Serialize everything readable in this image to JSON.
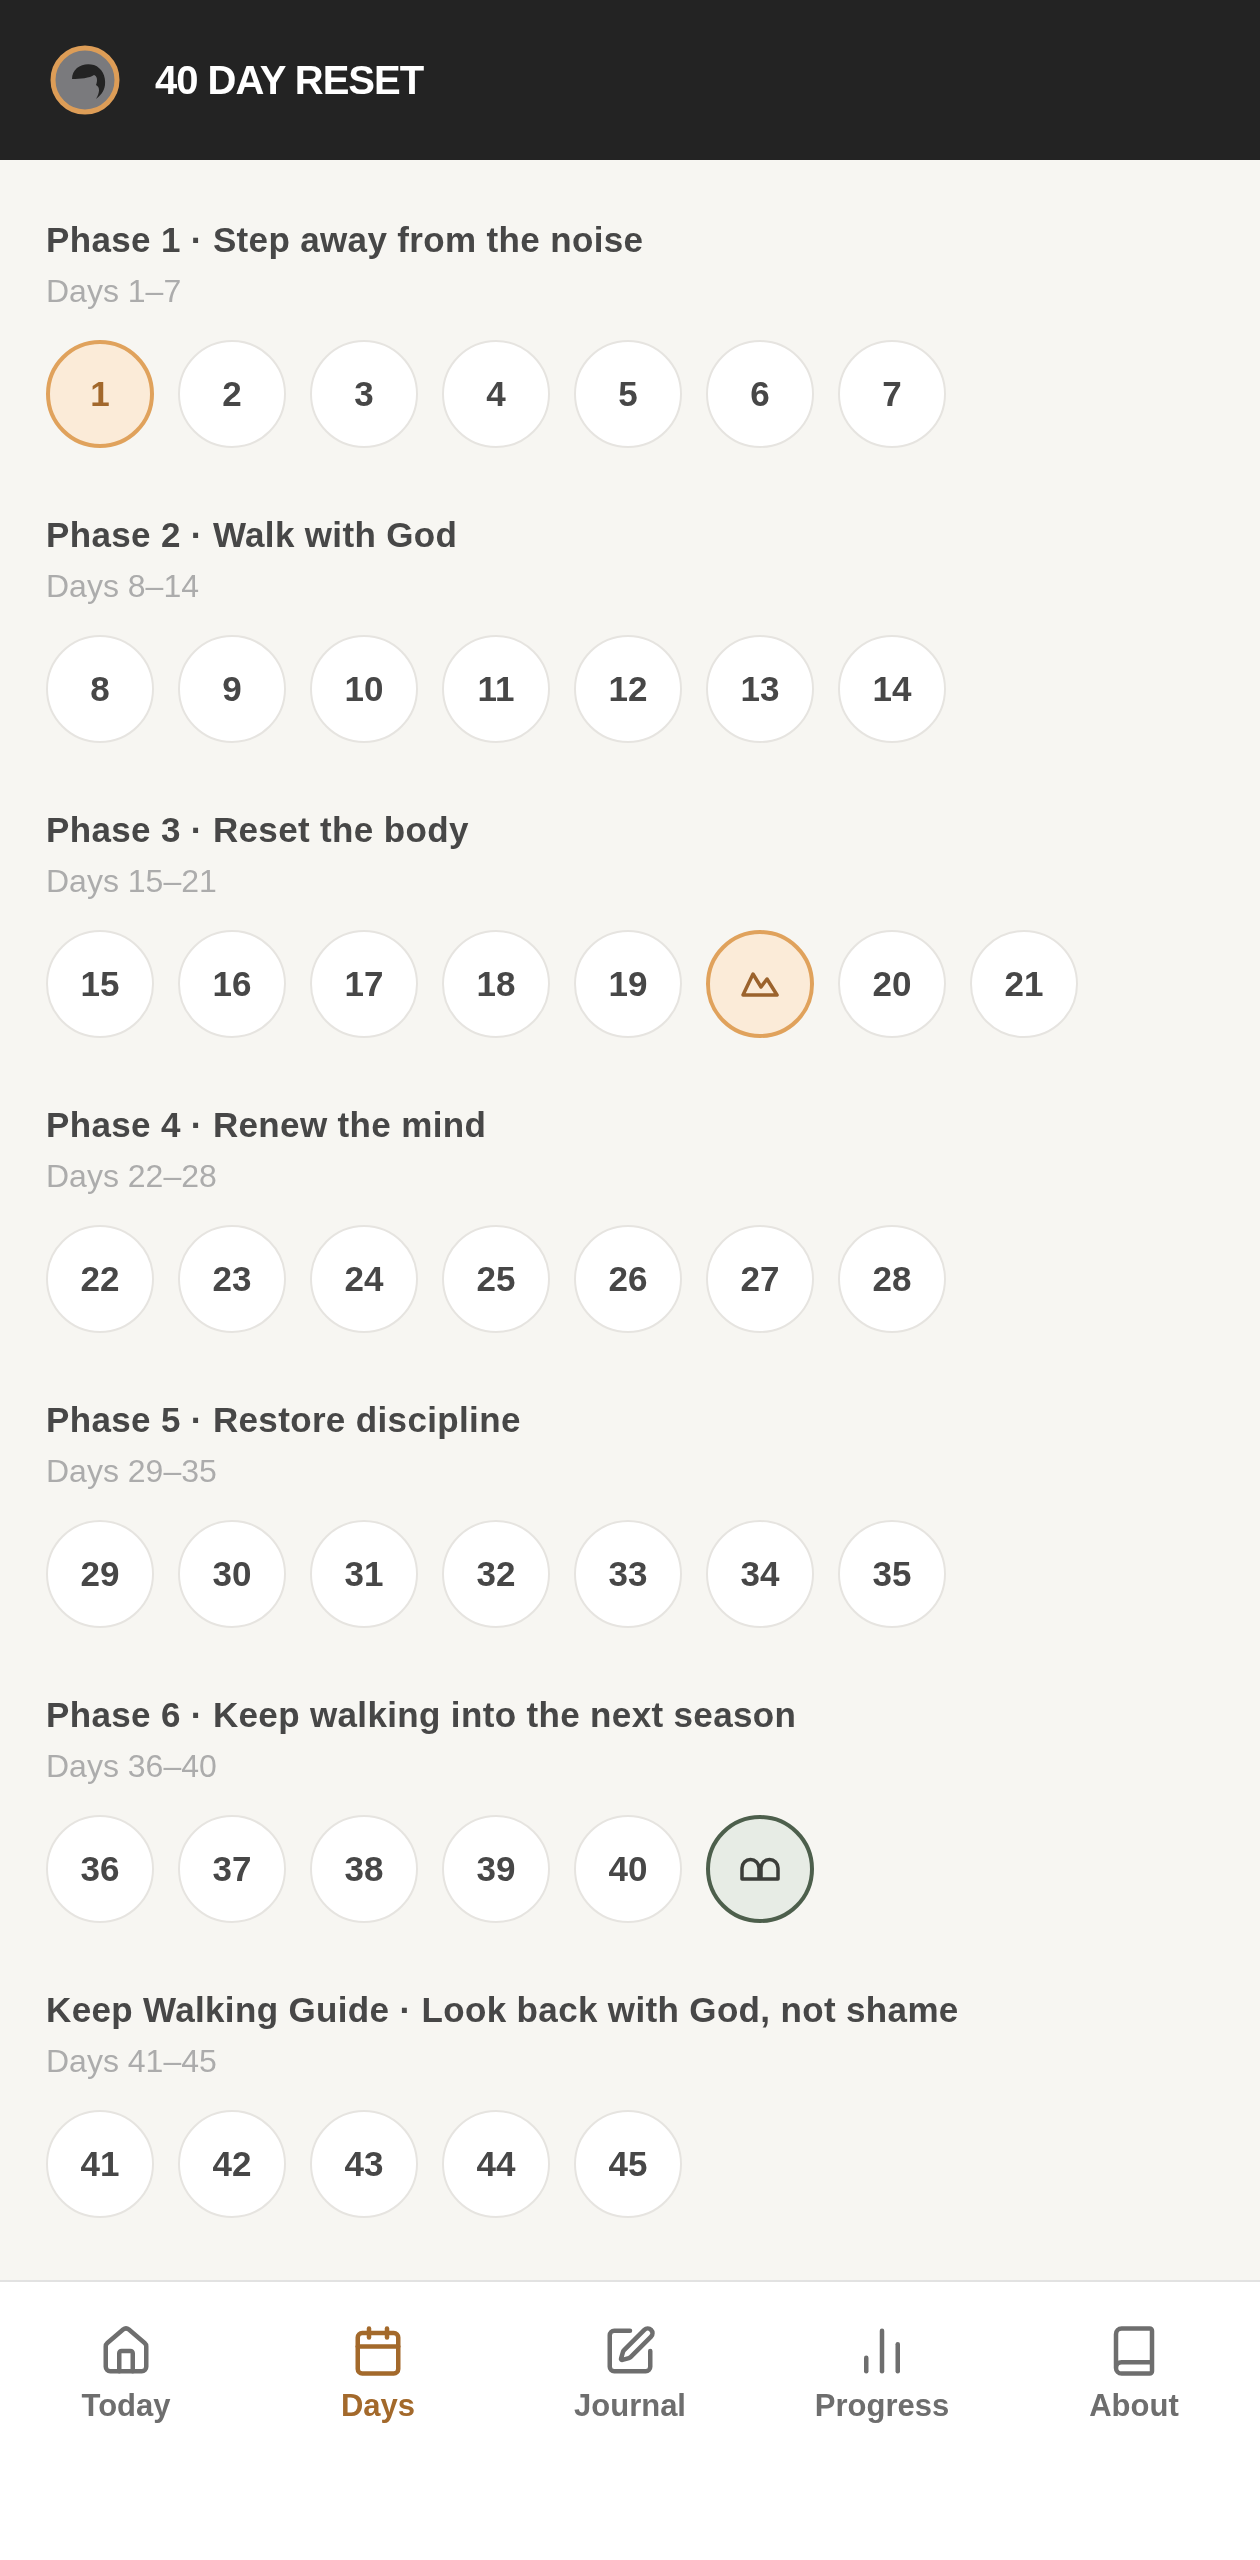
{
  "app_bar": {
    "title": "40 DAY RESET"
  },
  "phases": [
    {
      "title": "Phase 1 · Step away from the noise",
      "range": "Days 1–7",
      "days": [
        {
          "kind": "day",
          "label": "1",
          "selected": true
        },
        {
          "kind": "day",
          "label": "2",
          "selected": false
        },
        {
          "kind": "day",
          "label": "3",
          "selected": false
        },
        {
          "kind": "day",
          "label": "4",
          "selected": false
        },
        {
          "kind": "day",
          "label": "5",
          "selected": false
        },
        {
          "kind": "day",
          "label": "6",
          "selected": false
        },
        {
          "kind": "day",
          "label": "7",
          "selected": false
        }
      ]
    },
    {
      "title": "Phase 2 · Walk with God",
      "range": "Days 8–14",
      "days": [
        {
          "kind": "day",
          "label": "8",
          "selected": false
        },
        {
          "kind": "day",
          "label": "9",
          "selected": false
        },
        {
          "kind": "day",
          "label": "10",
          "selected": false
        },
        {
          "kind": "day",
          "label": "11",
          "selected": false
        },
        {
          "kind": "day",
          "label": "12",
          "selected": false
        },
        {
          "kind": "day",
          "label": "13",
          "selected": false
        },
        {
          "kind": "day",
          "label": "14",
          "selected": false
        }
      ]
    },
    {
      "title": "Phase 3 · Reset the body",
      "range": "Days 15–21",
      "days": [
        {
          "kind": "day",
          "label": "15",
          "selected": false
        },
        {
          "kind": "day",
          "label": "16",
          "selected": false
        },
        {
          "kind": "day",
          "label": "17",
          "selected": false
        },
        {
          "kind": "day",
          "label": "18",
          "selected": false
        },
        {
          "kind": "day",
          "label": "19",
          "selected": false
        },
        {
          "kind": "milestone",
          "selected": false
        },
        {
          "kind": "day",
          "label": "20",
          "selected": false
        },
        {
          "kind": "day",
          "label": "21",
          "selected": false
        }
      ]
    },
    {
      "title": "Phase 4 · Renew the mind",
      "range": "Days 22–28",
      "days": [
        {
          "kind": "day",
          "label": "22",
          "selected": false
        },
        {
          "kind": "day",
          "label": "23",
          "selected": false
        },
        {
          "kind": "day",
          "label": "24",
          "selected": false
        },
        {
          "kind": "day",
          "label": "25",
          "selected": false
        },
        {
          "kind": "day",
          "label": "26",
          "selected": false
        },
        {
          "kind": "day",
          "label": "27",
          "selected": false
        },
        {
          "kind": "day",
          "label": "28",
          "selected": false
        }
      ]
    },
    {
      "title": "Phase 5 · Restore discipline",
      "range": "Days 29–35",
      "days": [
        {
          "kind": "day",
          "label": "29",
          "selected": false
        },
        {
          "kind": "day",
          "label": "30",
          "selected": false
        },
        {
          "kind": "day",
          "label": "31",
          "selected": false
        },
        {
          "kind": "day",
          "label": "32",
          "selected": false
        },
        {
          "kind": "day",
          "label": "33",
          "selected": false
        },
        {
          "kind": "day",
          "label": "34",
          "selected": false
        },
        {
          "kind": "day",
          "label": "35",
          "selected": false
        }
      ]
    },
    {
      "title": "Phase 6 · Keep walking into the next season",
      "range": "Days 36–40",
      "days": [
        {
          "kind": "day",
          "label": "36",
          "selected": false
        },
        {
          "kind": "day",
          "label": "37",
          "selected": false
        },
        {
          "kind": "day",
          "label": "38",
          "selected": false
        },
        {
          "kind": "day",
          "label": "39",
          "selected": false
        },
        {
          "kind": "day",
          "label": "40",
          "selected": false
        },
        {
          "kind": "finale",
          "selected": false
        }
      ]
    },
    {
      "title": "Keep Walking Guide · Look back with God, not shame",
      "range": "Days 41–45",
      "days": [
        {
          "kind": "day",
          "label": "41",
          "selected": false
        },
        {
          "kind": "day",
          "label": "42",
          "selected": false
        },
        {
          "kind": "day",
          "label": "43",
          "selected": false
        },
        {
          "kind": "day",
          "label": "44",
          "selected": false
        },
        {
          "kind": "day",
          "label": "45",
          "selected": false
        }
      ]
    }
  ],
  "tab_bar": [
    {
      "label": "Today",
      "selected": false
    },
    {
      "label": "Days",
      "selected": true
    },
    {
      "label": "Journal",
      "selected": false
    },
    {
      "label": "Progress",
      "selected": false
    },
    {
      "label": "About",
      "selected": false
    }
  ]
}
